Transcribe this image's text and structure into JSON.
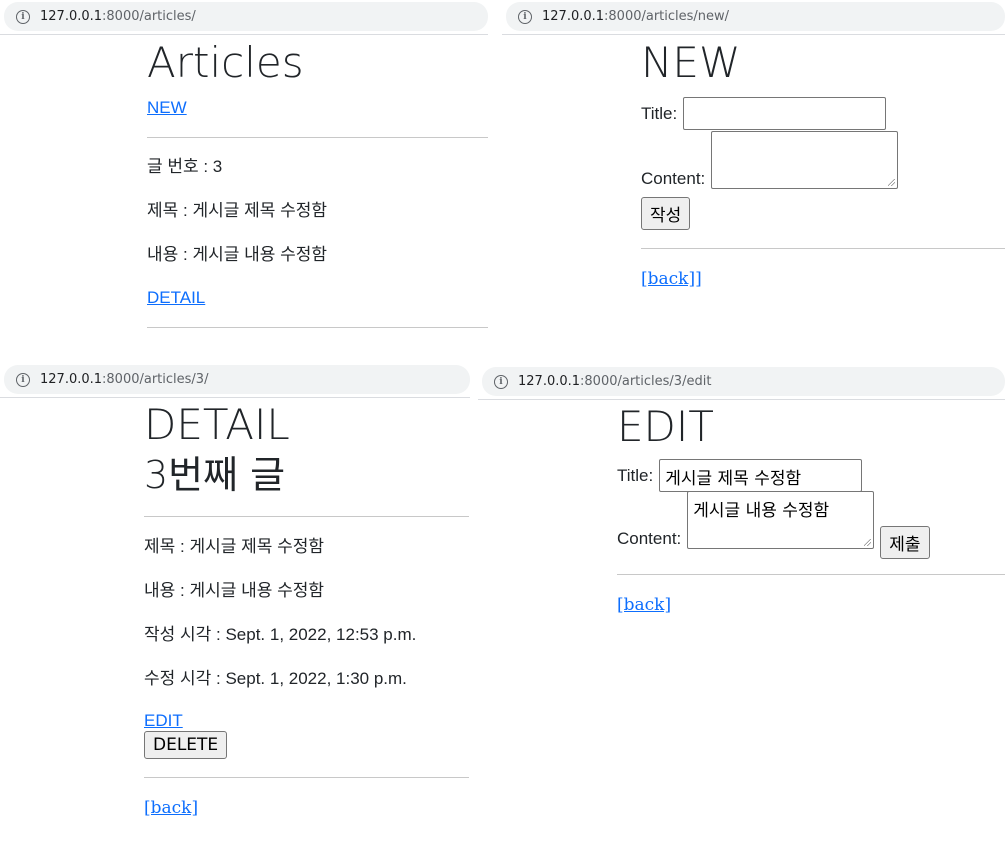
{
  "colors": {
    "link": "#0d6efd",
    "text": "#212529",
    "address_bar": "#f1f3f4"
  },
  "list_page": {
    "url_host": "127.0.0.1",
    "url_path": ":8000/articles/",
    "heading": "Articles",
    "new_link": "NEW",
    "number_line": "글 번호 : 3",
    "title_line": "제목 : 게시글 제목 수정함",
    "content_line": "내용 : 게시글 내용 수정함",
    "detail_link": "DETAIL"
  },
  "new_page": {
    "url_host": "127.0.0.1",
    "url_path": ":8000/articles/new/",
    "heading": "NEW",
    "title_label": "Title:",
    "content_label": "Content:",
    "submit_label": "작성",
    "back_link": "[back]]"
  },
  "detail_page": {
    "url_host": "127.0.0.1",
    "url_path": ":8000/articles/3/",
    "heading": "DETAIL",
    "subheading": "3번째 글",
    "title_line": "제목 : 게시글 제목 수정함",
    "content_line": "내용 : 게시글 내용 수정함",
    "created_line": "작성 시각 : Sept. 1, 2022, 12:53 p.m.",
    "updated_line": "수정 시각 : Sept. 1, 2022, 1:30 p.m.",
    "edit_link": "EDIT",
    "delete_label": "DELETE",
    "back_link": "[back]"
  },
  "edit_page": {
    "url_host": "127.0.0.1",
    "url_path": ":8000/articles/3/edit",
    "heading": "EDIT",
    "title_label": "Title:",
    "title_value": "게시글 제목 수정함",
    "content_label": "Content:",
    "content_value": "게시글 내용 수정함",
    "submit_label": "제출",
    "back_link": "[back]"
  }
}
